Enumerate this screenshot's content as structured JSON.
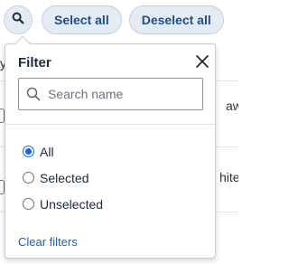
{
  "toolbar": {
    "select_all_label": "Select all",
    "deselect_all_label": "Deselect all"
  },
  "background": {
    "row1_fragment": "awg",
    "row2_fragment": "hite",
    "top_fragment": "y"
  },
  "filter_popover": {
    "title": "Filter",
    "search_placeholder": "Search name",
    "options": [
      {
        "label": "All",
        "selected": true
      },
      {
        "label": "Selected",
        "selected": false
      },
      {
        "label": "Unselected",
        "selected": false
      }
    ],
    "clear_label": "Clear filters"
  },
  "colors": {
    "accent": "#1a66d2",
    "pill_text": "#1f4f87",
    "pill_bg": "#e5ebf3",
    "link": "#1f5fae"
  },
  "icons": [
    "search-icon",
    "close-icon",
    "magnifier-icon"
  ]
}
